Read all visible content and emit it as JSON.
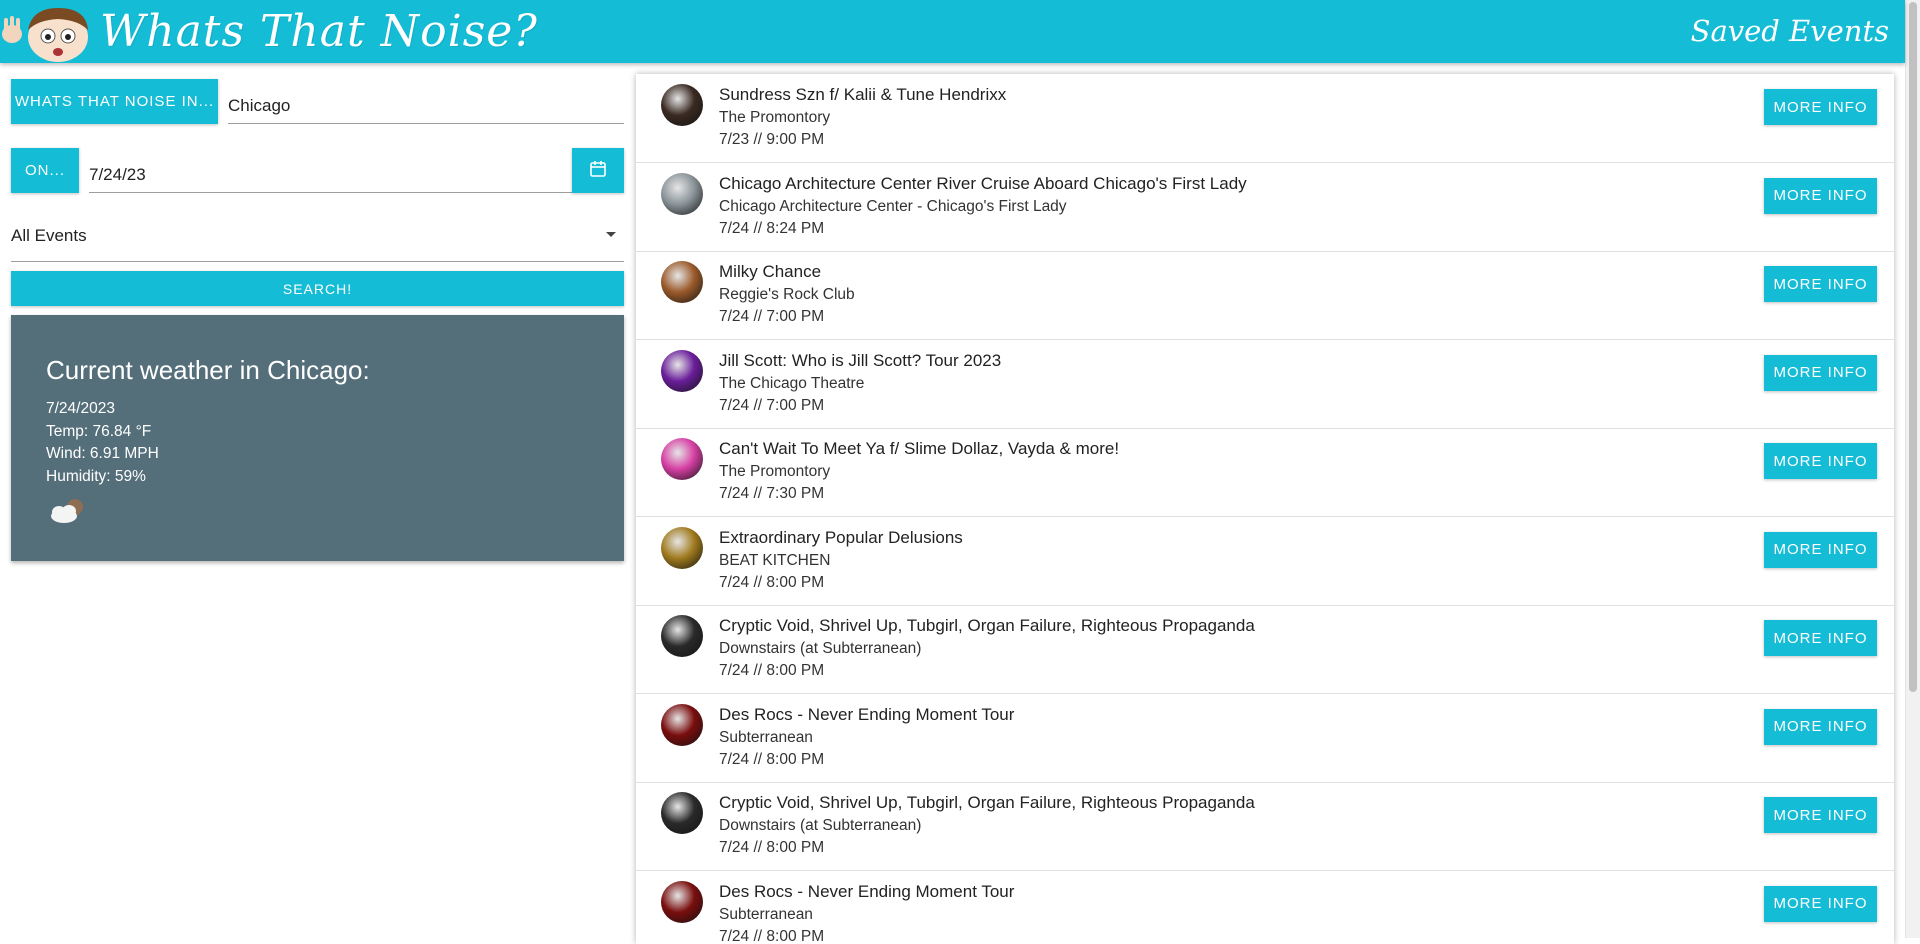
{
  "header": {
    "title": "Whats That Noise?",
    "saved_events_label": "Saved Events"
  },
  "search": {
    "location_button_label": "Whats That Noise In...",
    "location_value": "Chicago",
    "date_button_label": "On...",
    "date_value": "7/24/23",
    "category_value": "All Events",
    "search_button_label": "Search!"
  },
  "weather": {
    "heading": "Current weather in Chicago:",
    "date": "7/24/2023",
    "temp": "Temp: 76.84 °F",
    "wind": "Wind: 6.91 MPH",
    "humidity": "Humidity: 59%",
    "icon": "partly-cloudy-icon"
  },
  "events": {
    "more_info_label": "More Info",
    "items": [
      {
        "title": "Sundress Szn f/ Kalii & Tune Hendrixx",
        "venue": "The Promontory",
        "when": "7/23 // 9:00 PM",
        "avatar_color": "#3a2a22"
      },
      {
        "title": "Chicago Architecture Center River Cruise Aboard Chicago's First Lady",
        "venue": "Chicago Architecture Center - Chicago's First Lady",
        "when": "7/24 // 8:24 PM",
        "avatar_color": "#8a9499"
      },
      {
        "title": "Milky Chance",
        "venue": "Reggie's Rock Club",
        "when": "7/24 // 7:00 PM",
        "avatar_color": "#9a5a2a"
      },
      {
        "title": "Jill Scott: Who is Jill Scott? Tour 2023",
        "venue": "The Chicago Theatre",
        "when": "7/24 // 7:00 PM",
        "avatar_color": "#6a1e9a"
      },
      {
        "title": "Can't Wait To Meet Ya f/ Slime Dollaz, Vayda & more!",
        "venue": "The Promontory",
        "when": "7/24 // 7:30 PM",
        "avatar_color": "#d63fa3"
      },
      {
        "title": "Extraordinary Popular Delusions",
        "venue": "BEAT KITCHEN",
        "when": "7/24 // 8:00 PM",
        "avatar_color": "#a07a1e"
      },
      {
        "title": "Cryptic Void, Shrivel Up, Tubgirl, Organ Failure, Righteous Propaganda",
        "venue": "Downstairs (at Subterranean)",
        "when": "7/24 // 8:00 PM",
        "avatar_color": "#2a2a2a"
      },
      {
        "title": "Des Rocs - Never Ending Moment Tour",
        "venue": "Subterranean",
        "when": "7/24 // 8:00 PM",
        "avatar_color": "#7a0e0e"
      },
      {
        "title": "Cryptic Void, Shrivel Up, Tubgirl, Organ Failure, Righteous Propaganda",
        "venue": "Downstairs (at Subterranean)",
        "when": "7/24 // 8:00 PM",
        "avatar_color": "#2a2a2a"
      },
      {
        "title": "Des Rocs - Never Ending Moment Tour",
        "venue": "Subterranean",
        "when": "7/24 // 8:00 PM",
        "avatar_color": "#7a0e0e"
      }
    ]
  },
  "colors": {
    "accent": "#14bcd6",
    "weather_panel": "#546e7a"
  }
}
